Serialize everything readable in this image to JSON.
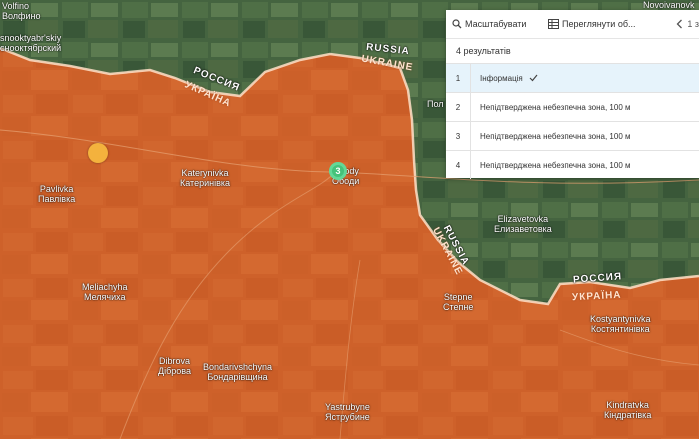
{
  "map": {
    "colors": {
      "occupied_fill": "#c9622b",
      "ukraine_border": "#ffe0c8",
      "russia_side": "#40633f",
      "cluster_marker": "#45c27a",
      "yellow_marker": "#f4b23d"
    },
    "labels": {
      "volfino": "Volfino\nВолфино",
      "krasnooktyabrskiy": "snooktyabr'skiy\nснооктябрский",
      "pavlivka": "Pavlivka\nПавлівка",
      "katerynivka": "Katerynivka\nКатеринівка",
      "obody": "Obody\nОбоди",
      "novoivanovka": "Novoivanovk",
      "pol": "Пол",
      "elizavetovka": "Elizavetovka\nЕлизаветовка",
      "meliachyha": "Meliachyha\nМелячиха",
      "stepne": "Stepne\nСтепне",
      "kostiantynivka": "Kostyantynivka\nКостянтинівка",
      "dibrova": "Dibrova\nДіброва",
      "bondarivshchyna": "Bondarivshchyna\nБондарівщина",
      "yastrubyne": "Yastrubyne\nЯструбине",
      "kindrativka": "Kindratvka\nКіндратівка"
    },
    "border_tags": {
      "russia_1": "RUSSIA",
      "ukraine_1": "UKRAINE",
      "rossiya_1": "РОССИЯ",
      "ukraina_1": "УКРАЇНА",
      "russia_2": "RUSSIA",
      "ukraine_2": "UKRAINE",
      "rossiya_2": "РОССИЯ",
      "ukraina_2": "УКРАЇНА"
    },
    "cluster_count": "3"
  },
  "panel": {
    "zoom_label": "Масштабувати",
    "view_label": "Переглянути об...",
    "nav_label": "1 з",
    "results_count": "4 результатів",
    "rows": [
      {
        "num": "1",
        "text": "Інформація",
        "selected": true
      },
      {
        "num": "2",
        "text": "Непідтверджена небезпечна зона, 100 м",
        "selected": false
      },
      {
        "num": "3",
        "text": "Непідтверджена небезпечна зона, 100 м",
        "selected": false
      },
      {
        "num": "4",
        "text": "Непідтверджена небезпечна зона, 100 м",
        "selected": false
      }
    ]
  }
}
